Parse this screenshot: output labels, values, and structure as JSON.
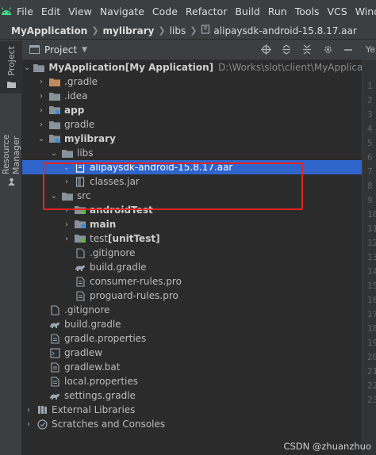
{
  "menubar": {
    "items": [
      "File",
      "Edit",
      "View",
      "Navigate",
      "Code",
      "Refactor",
      "Build",
      "Run",
      "Tools",
      "VCS",
      "Window"
    ]
  },
  "breadcrumbs": {
    "items": [
      "MyApplication",
      "mylibrary",
      "libs",
      "alipaysdk-android-15.8.17.aar"
    ]
  },
  "leftbar": {
    "project_tab": "Project",
    "resource_tab": "Resource Manager"
  },
  "panel": {
    "title": "Project"
  },
  "tree": [
    {
      "label": "MyApplication",
      "suffix": " [My Application]",
      "path": "D:\\Works\\slot\\client\\MyApplication"
    },
    {
      "label": ".gradle"
    },
    {
      "label": ".idea"
    },
    {
      "label": "app"
    },
    {
      "label": "gradle"
    },
    {
      "label": "mylibrary"
    },
    {
      "label": "libs"
    },
    {
      "label": "alipaysdk-android-15.8.17.aar"
    },
    {
      "label": "classes.jar"
    },
    {
      "label": "src"
    },
    {
      "label": "androidTest"
    },
    {
      "label": "main"
    },
    {
      "label": "test",
      "suffix": " [unitTest]"
    },
    {
      "label": ".gitignore"
    },
    {
      "label": "build.gradle"
    },
    {
      "label": "consumer-rules.pro"
    },
    {
      "label": "proguard-rules.pro"
    },
    {
      "label": ".gitignore"
    },
    {
      "label": "build.gradle"
    },
    {
      "label": "gradle.properties"
    },
    {
      "label": "gradlew"
    },
    {
      "label": "gradlew.bat"
    },
    {
      "label": "local.properties"
    },
    {
      "label": "settings.gradle"
    },
    {
      "label": "External Libraries"
    },
    {
      "label": "Scratches and Consoles"
    }
  ],
  "editor": {
    "tab_label": "Ye",
    "line_numbers": [
      "1",
      "2",
      "3",
      "4",
      "5",
      "6",
      "7",
      "8",
      "9",
      "10",
      "11",
      "12",
      "13",
      "14",
      "15",
      "16",
      "17",
      "18",
      "19",
      "20",
      "21",
      "22",
      "23"
    ]
  },
  "watermark": "CSDN @zhuanzhuo",
  "colors": {
    "selection": "#2f65ca",
    "highlight_box": "#e32424",
    "folder": "#87939a",
    "module_folder": "#c18b5b",
    "android_green": "#3ddc84"
  }
}
